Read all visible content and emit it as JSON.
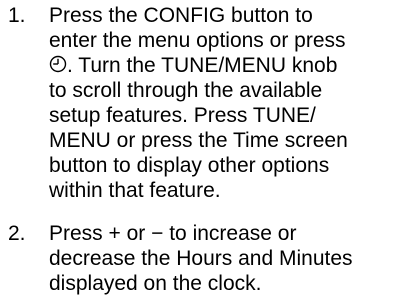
{
  "steps": [
    {
      "number": "1.",
      "lines": [
        "Press the CONFIG button to",
        "enter the menu options or press",
        ". Turn the TUNE/MENU knob",
        "to scroll through the available",
        "setup features. Press TUNE/",
        "MENU or press the Time screen",
        "button to display other options",
        "within that feature."
      ],
      "inline_icon": "clock-icon"
    },
    {
      "number": "2.",
      "lines": [
        "Press + or − to increase or",
        "decrease the Hours and Minutes",
        "displayed on the clock."
      ]
    }
  ]
}
